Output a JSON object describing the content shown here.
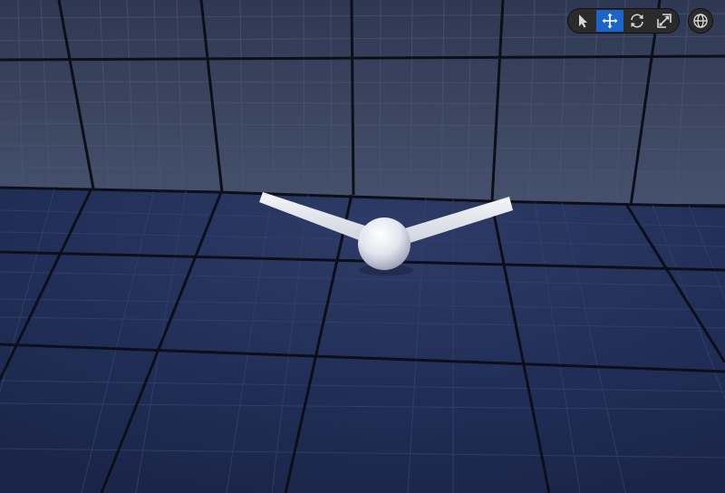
{
  "viewport": {
    "toolbar": {
      "tools": [
        {
          "icon": "select-arrow-icon",
          "active": false
        },
        {
          "icon": "translate-move-icon",
          "active": true
        },
        {
          "icon": "rotate-icon",
          "active": false
        },
        {
          "icon": "scale-icon",
          "active": false
        }
      ],
      "coordinate_space_icon": "globe-world-space-icon"
    },
    "colors": {
      "grid_wall": "#39445f",
      "grid_floor": "#22305a",
      "grid_lines": "#0c0f18",
      "accent_active": "#1c64c9",
      "mesh": "#e8ebf2"
    }
  }
}
